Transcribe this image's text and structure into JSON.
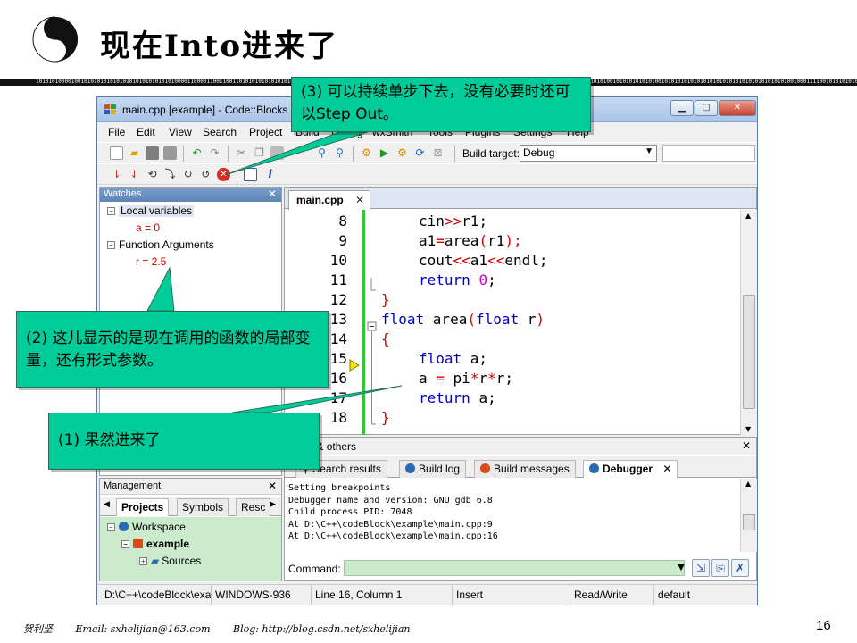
{
  "slide": {
    "title": "现在Into进来了",
    "binary_strip": "10101010000100101010101010101010101010101010000110000110011001101010101010101010101010101010101010101010101010101010101010101010101010101010101010101010101010101010101010101010100101010101010100101010101010101010101010101010101010101001000111100101010101010101000101010100101010101010101010101010101",
    "footer": {
      "author": "贺利坚",
      "email": "Email:  sxhelijian@163.com",
      "blog": "Blog:  http://blog.csdn.net/sxhelijian"
    },
    "page_number": "16"
  },
  "window": {
    "title": "main.cpp [example] - Code::Blocks",
    "menu": [
      "File",
      "Edit",
      "View",
      "Search",
      "Project",
      "Build",
      "Debug",
      "wxSmith",
      "Tools",
      "Plugins",
      "Settings",
      "Help"
    ],
    "build_target_label": "Build target:",
    "build_target_value": "Debug"
  },
  "watches": {
    "title": "Watches",
    "local_variables_label": "Local variables",
    "local_var": "a = 0",
    "function_arguments_label": "Function Arguments",
    "function_arg": "r = 2.5"
  },
  "editor": {
    "tab_label": "main.cpp",
    "lines": [
      {
        "num": "8",
        "code": [
          {
            "t": "cin",
            "c": "plain"
          },
          {
            "t": ">>",
            "c": "op"
          },
          {
            "t": "r1;",
            "c": "plain"
          }
        ],
        "indent": 2
      },
      {
        "num": "9",
        "code": [
          {
            "t": "a1",
            "c": "plain"
          },
          {
            "t": "=",
            "c": "op"
          },
          {
            "t": "area",
            "c": "plain"
          },
          {
            "t": "(",
            "c": "op"
          },
          {
            "t": "r1",
            "c": "plain"
          },
          {
            "t": ");",
            "c": "op"
          }
        ],
        "indent": 2
      },
      {
        "num": "10",
        "code": [
          {
            "t": "cout",
            "c": "plain"
          },
          {
            "t": "<<",
            "c": "op"
          },
          {
            "t": "a1",
            "c": "plain"
          },
          {
            "t": "<<",
            "c": "op"
          },
          {
            "t": "endl;",
            "c": "plain"
          }
        ],
        "indent": 2
      },
      {
        "num": "11",
        "code": [
          {
            "t": "return ",
            "c": "kw"
          },
          {
            "t": "0",
            "c": "num"
          },
          {
            "t": ";",
            "c": "plain"
          }
        ],
        "indent": 2
      },
      {
        "num": "12",
        "code": [
          {
            "t": "}",
            "c": "op"
          }
        ],
        "indent": 0
      },
      {
        "num": "13",
        "code": [
          {
            "t": "float ",
            "c": "kw"
          },
          {
            "t": "area",
            "c": "plain"
          },
          {
            "t": "(",
            "c": "op"
          },
          {
            "t": "float ",
            "c": "kw"
          },
          {
            "t": "r",
            "c": "plain"
          },
          {
            "t": ")",
            "c": "op"
          }
        ],
        "indent": 0
      },
      {
        "num": "14",
        "code": [
          {
            "t": "{",
            "c": "op"
          }
        ],
        "indent": 0
      },
      {
        "num": "15",
        "code": [
          {
            "t": "float ",
            "c": "kw"
          },
          {
            "t": "a;",
            "c": "plain"
          }
        ],
        "indent": 2
      },
      {
        "num": "16",
        "code": [
          {
            "t": "a ",
            "c": "plain"
          },
          {
            "t": "=",
            "c": "op"
          },
          {
            "t": " pi",
            "c": "plain"
          },
          {
            "t": "*",
            "c": "op"
          },
          {
            "t": "r",
            "c": "plain"
          },
          {
            "t": "*",
            "c": "op"
          },
          {
            "t": "r;",
            "c": "plain"
          }
        ],
        "indent": 2
      },
      {
        "num": "17",
        "code": [
          {
            "t": "return ",
            "c": "kw"
          },
          {
            "t": "a;",
            "c": "plain"
          }
        ],
        "indent": 2
      },
      {
        "num": "18",
        "code": [
          {
            "t": "}",
            "c": "op"
          }
        ],
        "indent": 0
      }
    ]
  },
  "logs": {
    "title": "Logs & others",
    "tabs": [
      "Search results",
      "Build log",
      "Build messages",
      "Debugger"
    ],
    "active_tab": "Debugger",
    "text": "Setting breakpoints\nDebugger name and version: GNU gdb 6.8\nChild process PID: 7048\nAt D:\\C++\\codeBlock\\example\\main.cpp:9\nAt D:\\C++\\codeBlock\\example\\main.cpp:16",
    "command_label": "Command:"
  },
  "management": {
    "title": "Management",
    "tabs": [
      "Projects",
      "Symbols",
      "Resc"
    ],
    "workspace": "Workspace",
    "project": "example",
    "sources": "Sources"
  },
  "statusbar": {
    "path": "D:\\C++\\codeBlock\\example\\main.cpp",
    "encoding": "WINDOWS-936",
    "position": "Line 16, Column 1",
    "mode": "Insert",
    "access": "Read/Write",
    "lang": "default"
  },
  "callouts": {
    "c3": "(3) 可以持续单步下去，没有必要时还可以Step Out。",
    "c2": "(2) 这儿显示的是现在调用的函数的局部变量，还有形式参数。",
    "c1": "(1) 果然进来了"
  },
  "colors": {
    "callout_bg": "#00cc99",
    "change_bar": "#31c731",
    "keyword": "#0000c8",
    "operator": "#d40000",
    "number": "#d000d0"
  }
}
